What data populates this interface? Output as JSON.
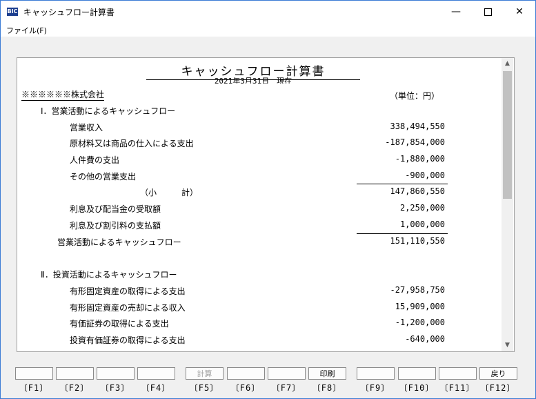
{
  "window": {
    "title": "キャッシュフロー計算書",
    "icon_text": "BIC"
  },
  "menu": {
    "file": "ファイル(F)"
  },
  "report": {
    "title": "キャッシュフロー計算書",
    "date": "2021年3月31日　現在",
    "company": "※※※※※※株式会社",
    "unit": "（単位：円）",
    "rows": [
      {
        "label": "Ⅰ．営業活動によるキャッシュフロー",
        "value": ""
      },
      {
        "label": "営業収入",
        "value": "338,494,550"
      },
      {
        "label": "原材料又は商品の仕入による支出",
        "value": "-187,854,000"
      },
      {
        "label": "人件費の支出",
        "value": "-1,880,000"
      },
      {
        "label": "その他の営業支出",
        "value": "-900,000"
      },
      {
        "label": "（小　　　計）",
        "value": "147,860,550"
      },
      {
        "label": "利息及び配当金の受取額",
        "value": "2,250,000"
      },
      {
        "label": "利息及び割引料の支払額",
        "value": "1,000,000"
      },
      {
        "label": "営業活動によるキャッシュフロー",
        "value": "151,110,550"
      },
      {
        "label": "Ⅱ．投資活動によるキャッシュフロー",
        "value": ""
      },
      {
        "label": "有形固定資産の取得による支出",
        "value": "-27,958,750"
      },
      {
        "label": "有形固定資産の売却による収入",
        "value": "15,909,000"
      },
      {
        "label": "有価証券の取得による支出",
        "value": "-1,200,000"
      },
      {
        "label": "投資有価証券の取得による支出",
        "value": "-640,000"
      }
    ]
  },
  "fkeys": [
    {
      "key": "〔F1〕",
      "label": ""
    },
    {
      "key": "〔F2〕",
      "label": ""
    },
    {
      "key": "〔F3〕",
      "label": ""
    },
    {
      "key": "〔F4〕",
      "label": ""
    },
    {
      "key": "〔F5〕",
      "label": "計算"
    },
    {
      "key": "〔F6〕",
      "label": ""
    },
    {
      "key": "〔F7〕",
      "label": ""
    },
    {
      "key": "〔F8〕",
      "label": "印刷"
    },
    {
      "key": "〔F9〕",
      "label": ""
    },
    {
      "key": "〔F10〕",
      "label": ""
    },
    {
      "key": "〔F11〕",
      "label": ""
    },
    {
      "key": "〔F12〕",
      "label": "戻り"
    }
  ]
}
